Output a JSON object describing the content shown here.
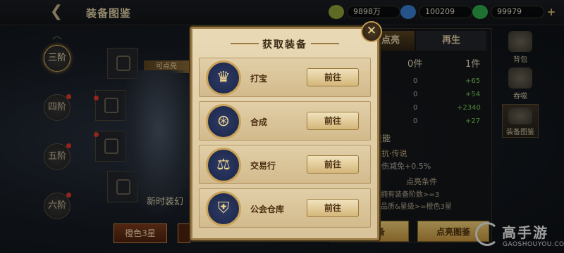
{
  "header": {
    "title": "装备图鉴",
    "back_icon": "back-arrow-icon"
  },
  "currencies": [
    {
      "icon": "leaf-coin-icon",
      "color": "#8fa23a",
      "value": "9898万"
    },
    {
      "icon": "blue-diamond-icon",
      "color": "#3a7fd1",
      "value": "100209"
    },
    {
      "icon": "green-diamond-icon",
      "color": "#2fae4a",
      "value": "99979"
    }
  ],
  "tiers": [
    "三阶",
    "四阶",
    "五阶",
    "六阶"
  ],
  "left": {
    "lit_tag": "可点亮",
    "new_label": "新时装幻",
    "quality_button": "橙色3星"
  },
  "right_panel": {
    "tabs": [
      "点亮",
      "再生"
    ],
    "col_heads": [
      "0件",
      "1件"
    ],
    "stats": [
      {
        "left": "0",
        "right": "+65"
      },
      {
        "left": "0",
        "right": "+54"
      },
      {
        "left": "0",
        "right": "+2340"
      },
      {
        "left": "0",
        "right": "+27"
      }
    ],
    "skill_title": "技能",
    "skill_line1": "压抗·传说",
    "skill_line2": "暴伤减免+0.5%",
    "condition_title": "点亮条件",
    "condition_1": "拥有装备阶数>=3",
    "condition_2": "品质&星级>=橙色3星",
    "btn_left": "装备",
    "btn_right": "点亮图鉴"
  },
  "side_nav": [
    {
      "icon": "backpack-icon",
      "label": "背包"
    },
    {
      "icon": "devour-icon",
      "label": "吞噬"
    },
    {
      "icon": "equipment-atlas-icon",
      "label": "装备图鉴"
    }
  ],
  "modal": {
    "title": "获取装备",
    "close_icon": "close-icon",
    "sources": [
      {
        "name": "打宝",
        "icon": "boss-mask-icon",
        "glyph": "♛",
        "button": "前往"
      },
      {
        "name": "合成",
        "icon": "synthesis-icon",
        "glyph": "⊛",
        "button": "前往"
      },
      {
        "name": "交易行",
        "icon": "scales-icon",
        "glyph": "⚖",
        "button": "前往"
      },
      {
        "name": "公会仓库",
        "icon": "guild-shield-icon",
        "glyph": "⛨",
        "button": "前往"
      }
    ]
  },
  "watermark": {
    "name": "高手游",
    "sub": "GAOSHOUYOU.COM"
  }
}
